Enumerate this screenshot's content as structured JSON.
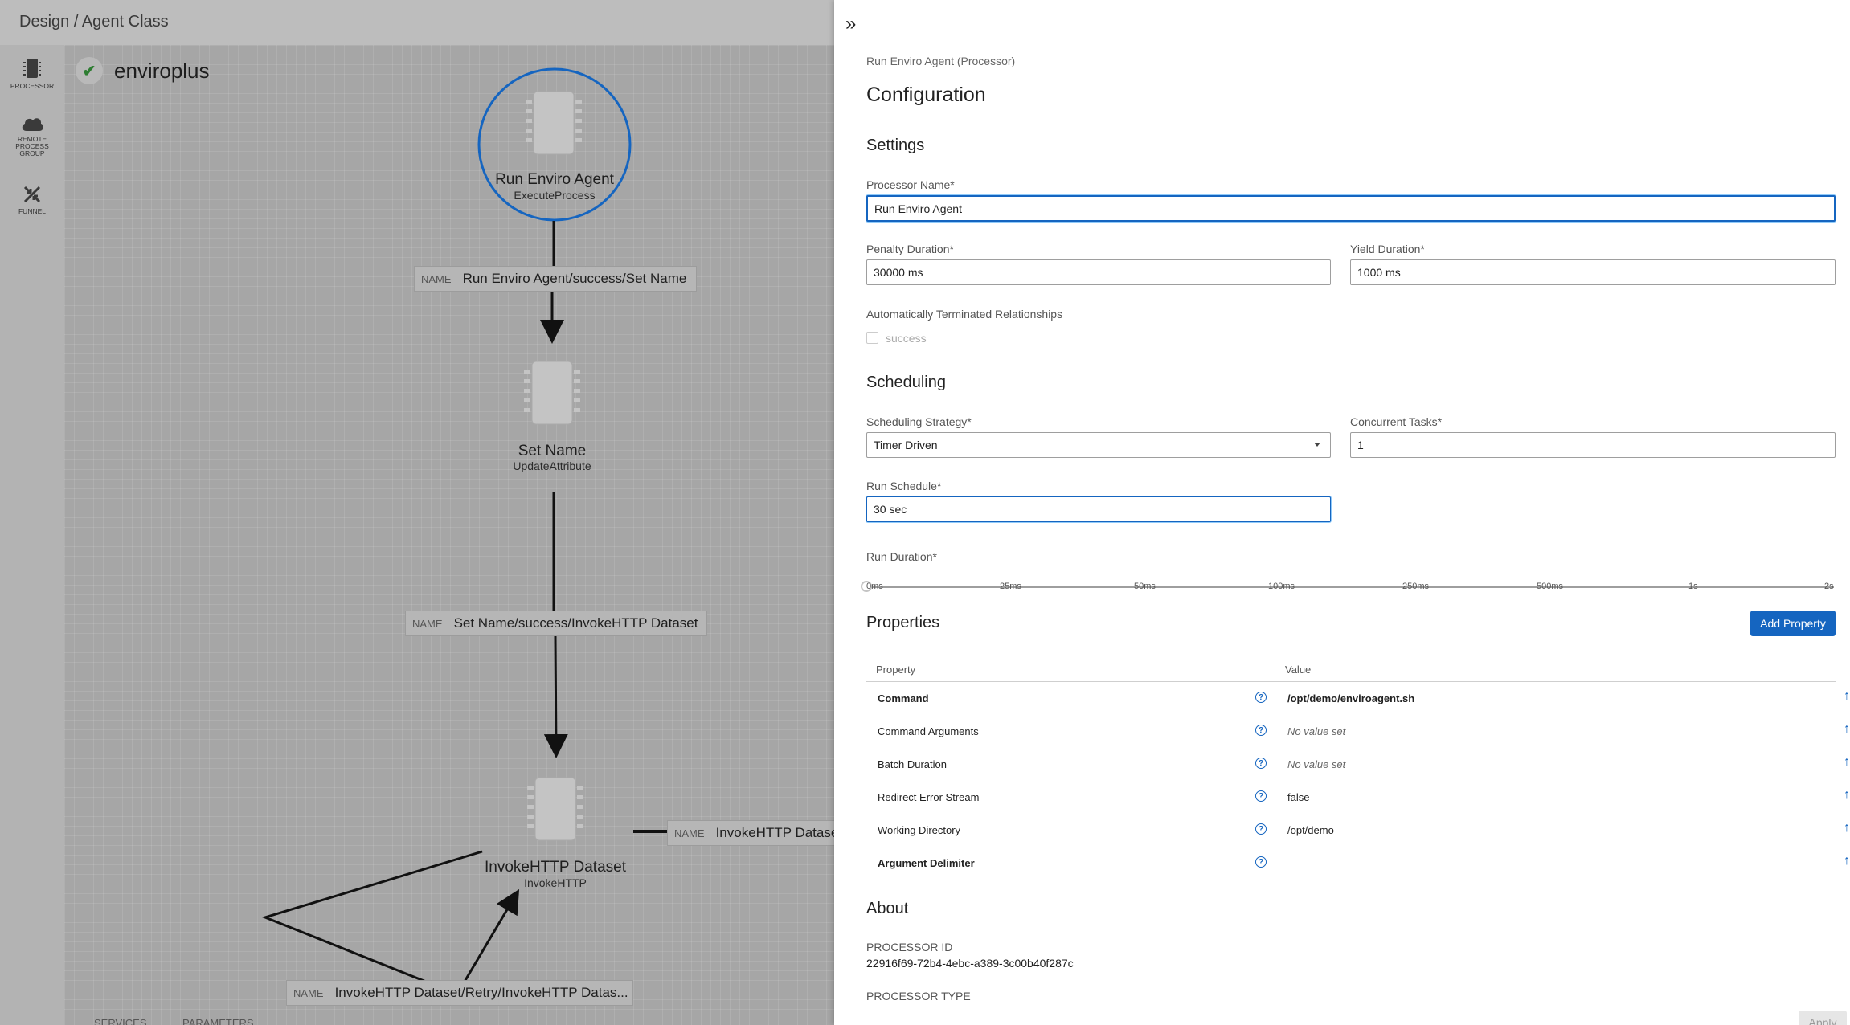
{
  "header": {
    "breadcrumb": "Design / Agent Class"
  },
  "toolbar": {
    "processor": "PROCESSOR",
    "remote_group": [
      "REMOTE",
      "PROCESS",
      "GROUP"
    ],
    "funnel": "FUNNEL"
  },
  "canvas": {
    "flow_name": "enviroplus",
    "nodes": [
      {
        "title": "Run Enviro Agent",
        "type": "ExecuteProcess"
      },
      {
        "title": "Set Name",
        "type": "UpdateAttribute"
      },
      {
        "title": "InvokeHTTP Dataset",
        "type": "InvokeHTTP"
      }
    ],
    "connections": [
      {
        "key": "NAME",
        "value": "Run Enviro Agent/success/Set Name"
      },
      {
        "key": "NAME",
        "value": "Set Name/success/InvokeHTTP Dataset"
      },
      {
        "key": "NAME",
        "value": "InvokeHTTP Datase"
      },
      {
        "key": "NAME",
        "value": "InvokeHTTP Dataset/Retry/InvokeHTTP Datas..."
      }
    ],
    "bottom_tabs": [
      "SERVICES",
      "PARAMETERS"
    ]
  },
  "panel": {
    "subtitle": "Run Enviro Agent (Processor)",
    "title": "Configuration",
    "settings": {
      "heading": "Settings",
      "processor_name_label": "Processor Name*",
      "processor_name": "Run Enviro Agent",
      "penalty_label": "Penalty Duration*",
      "penalty": "30000 ms",
      "yield_label": "Yield Duration*",
      "yield": "1000 ms",
      "auto_term_label": "Automatically Terminated Relationships",
      "auto_term_option": "success"
    },
    "scheduling": {
      "heading": "Scheduling",
      "strategy_label": "Scheduling Strategy*",
      "strategy": "Timer Driven",
      "tasks_label": "Concurrent Tasks*",
      "tasks": "1",
      "run_schedule_label": "Run Schedule*",
      "run_schedule": "30 sec",
      "run_duration_label": "Run Duration*",
      "run_duration_ticks": [
        "0ms",
        "25ms",
        "50ms",
        "100ms",
        "250ms",
        "500ms",
        "1s",
        "2s"
      ],
      "run_duration_selected": "0ms"
    },
    "properties": {
      "heading": "Properties",
      "add_button": "Add Property",
      "col_property": "Property",
      "col_value": "Value",
      "rows": [
        {
          "name": "Command",
          "value": "/opt/demo/enviroagent.sh"
        },
        {
          "name": "Command Arguments",
          "value": "No value set"
        },
        {
          "name": "Batch Duration",
          "value": "No value set"
        },
        {
          "name": "Redirect Error Stream",
          "value": "false"
        },
        {
          "name": "Working Directory",
          "value": "/opt/demo"
        },
        {
          "name": "Argument Delimiter",
          "value": ""
        }
      ]
    },
    "about": {
      "heading": "About",
      "id_label": "PROCESSOR ID",
      "id": "22916f69-72b4-4ebc-a389-3c00b40f287c",
      "type_label": "PROCESSOR TYPE"
    },
    "apply": "Apply"
  },
  "colors": {
    "accent": "#1565c0",
    "success": "#2e7d32",
    "canvas_dim": "#a6a6a6"
  },
  "icons": {
    "collapse": "double-chevron-right-icon",
    "help": "help-circle-icon",
    "move_up": "arrow-up-icon",
    "check": "check-icon"
  }
}
